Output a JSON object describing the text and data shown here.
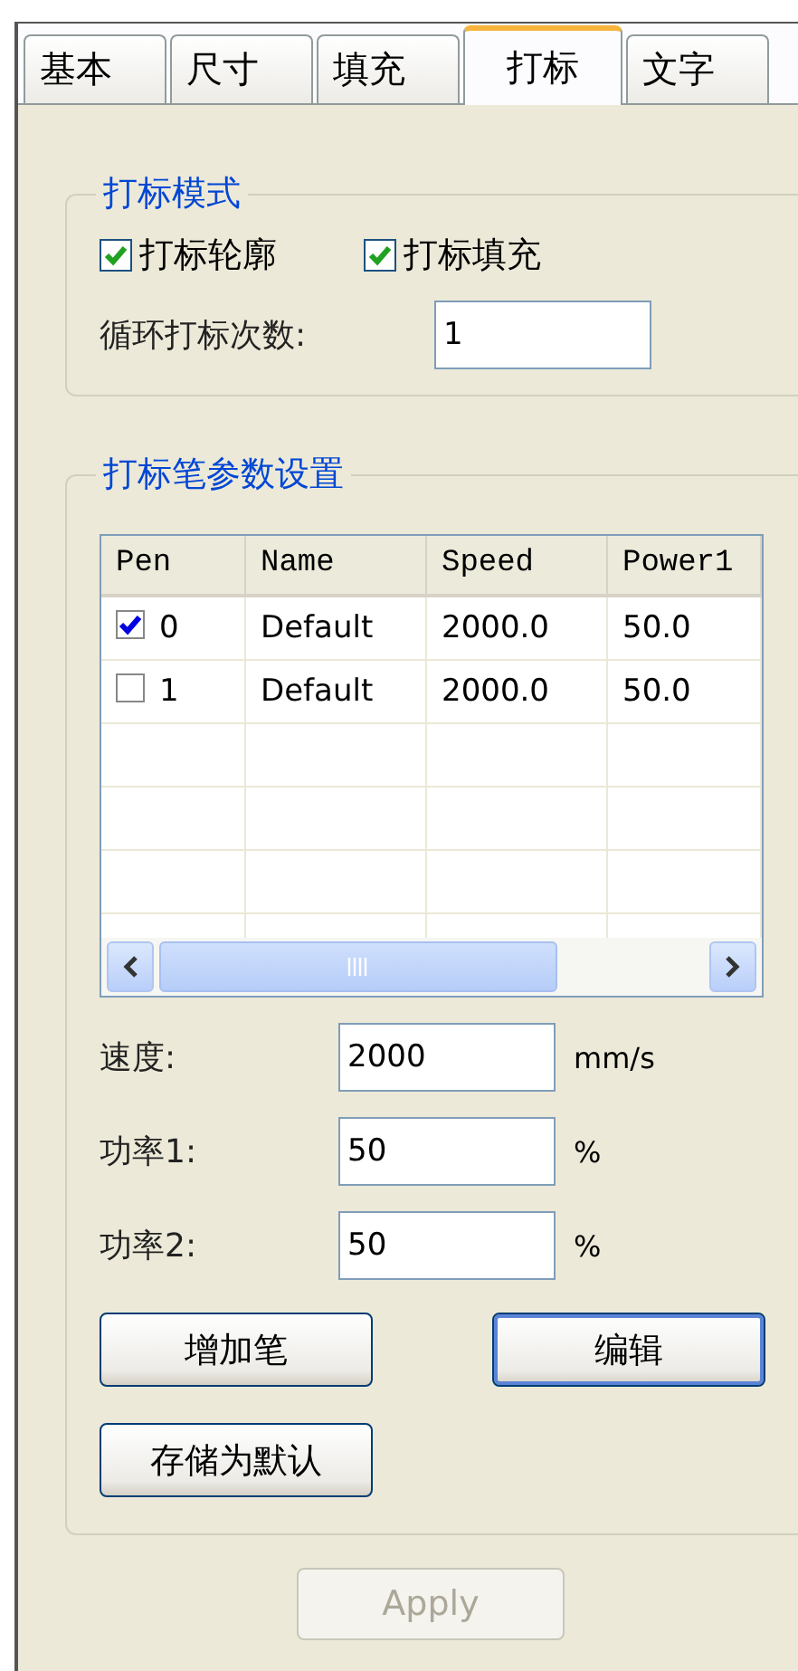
{
  "tabs": [
    {
      "label": "基本",
      "selected": false
    },
    {
      "label": "尺寸",
      "selected": false
    },
    {
      "label": "填充",
      "selected": false
    },
    {
      "label": "打标",
      "selected": true
    },
    {
      "label": "文字",
      "selected": false
    }
  ],
  "mark_mode": {
    "title": "打标模式",
    "options": [
      {
        "label": "打标轮廓",
        "checked": true
      },
      {
        "label": "打标填充",
        "checked": true
      }
    ],
    "loop_label": "循环打标次数:",
    "loop_value": "1"
  },
  "pen_params": {
    "title": "打标笔参数设置",
    "table": {
      "columns": [
        "Pen",
        "Name",
        "Speed",
        "Power1"
      ],
      "rows": [
        {
          "checked": true,
          "cells": [
            "0",
            "Default",
            "2000.0",
            "50.0"
          ]
        },
        {
          "checked": false,
          "cells": [
            "1",
            "Default",
            "2000.0",
            "50.0"
          ]
        }
      ]
    },
    "fields": [
      {
        "label": "速度:",
        "value": "2000",
        "unit": "mm/s"
      },
      {
        "label": "功率1:",
        "value": "50",
        "unit": "%"
      },
      {
        "label": "功率2:",
        "value": "50",
        "unit": "%"
      }
    ],
    "buttons": [
      {
        "label": "增加笔",
        "focused": false
      },
      {
        "label": "编辑",
        "focused": true
      },
      {
        "label": "存储为默认",
        "focused": false
      }
    ]
  },
  "apply_button": {
    "label": "Apply",
    "disabled": true
  }
}
